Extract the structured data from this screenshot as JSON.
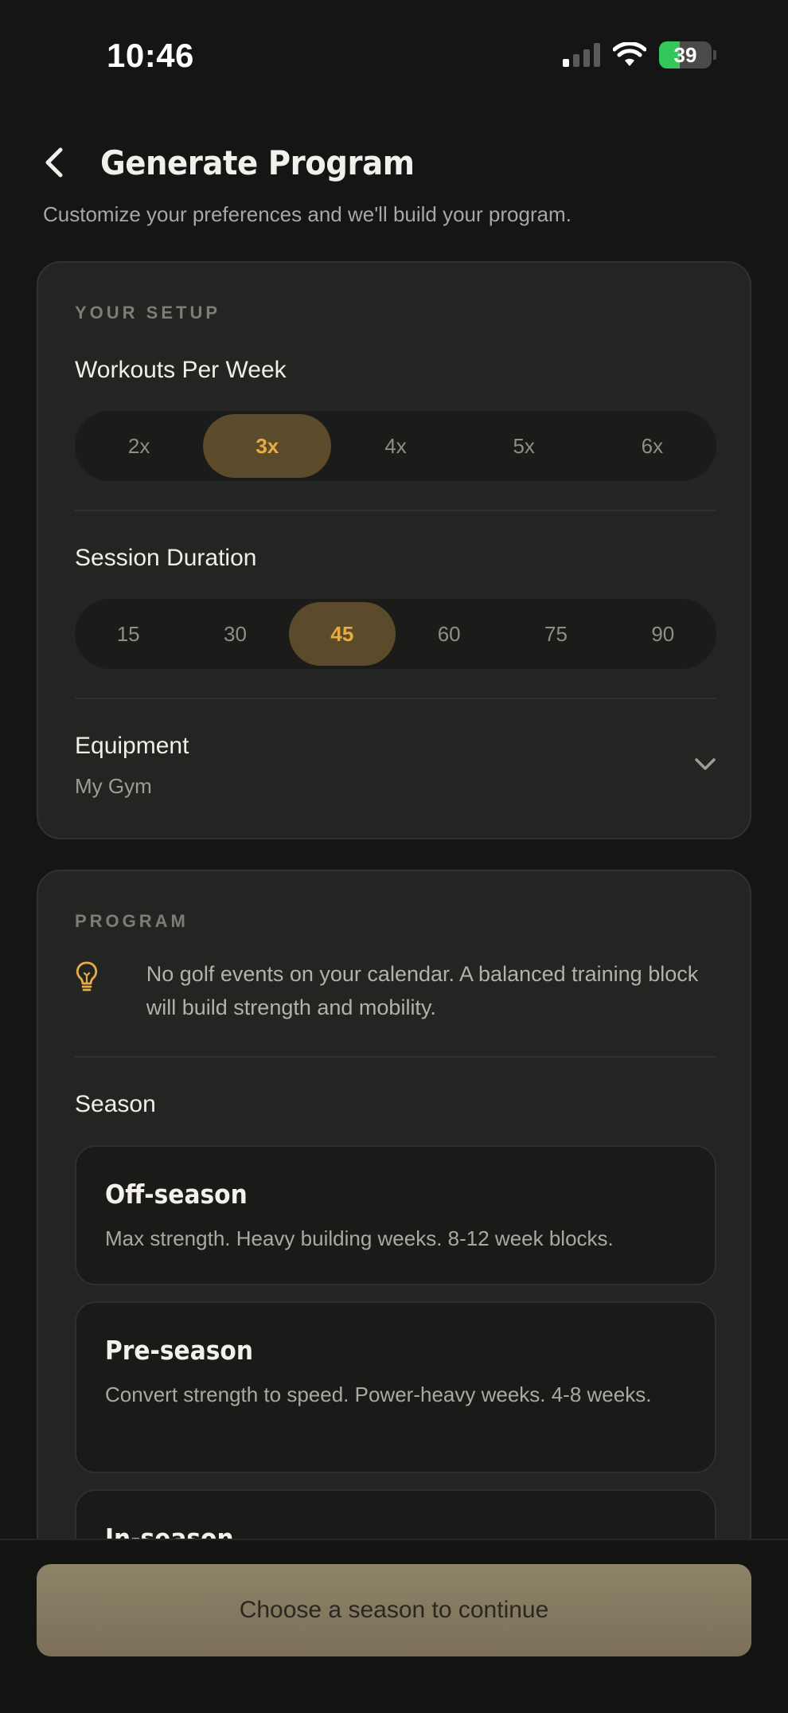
{
  "status_bar": {
    "time": "10:46",
    "battery_level": "39",
    "signal_icon": "cellular-signal-icon",
    "wifi_icon": "wifi-icon",
    "battery_icon": "battery-charging-icon"
  },
  "header": {
    "back_icon": "chevron-left-icon",
    "title": "Generate Program",
    "subtitle": "Customize your preferences and we'll build your program."
  },
  "setup": {
    "section_label": "YOUR SETUP",
    "workouts": {
      "title": "Workouts Per Week",
      "options": [
        "2x",
        "3x",
        "4x",
        "5x",
        "6x"
      ],
      "selected": "3x"
    },
    "duration": {
      "title": "Session Duration",
      "options": [
        "15",
        "30",
        "45",
        "60",
        "75",
        "90"
      ],
      "selected": "45"
    },
    "equipment": {
      "title": "Equipment",
      "value": "My Gym",
      "icon": "chevron-down-icon"
    }
  },
  "program": {
    "section_label": "PROGRAM",
    "tip_icon": "lightbulb-icon",
    "tip_text": "No golf events on your calendar. A balanced training block will build strength and mobility.",
    "season_title": "Season",
    "seasons": [
      {
        "name": "Off-season",
        "desc": "Max strength. Heavy building weeks. 8-12 week blocks."
      },
      {
        "name": "Pre-season",
        "desc": "Convert strength to speed. Power-heavy weeks. 4-8 weeks."
      },
      {
        "name": "In-season",
        "desc": ""
      }
    ]
  },
  "footer": {
    "cta_label": "Choose a season to continue"
  },
  "colors": {
    "accent": "#e6ad45",
    "accent_bg": "#5b4b2a",
    "background": "#141514",
    "card": "#232522"
  }
}
